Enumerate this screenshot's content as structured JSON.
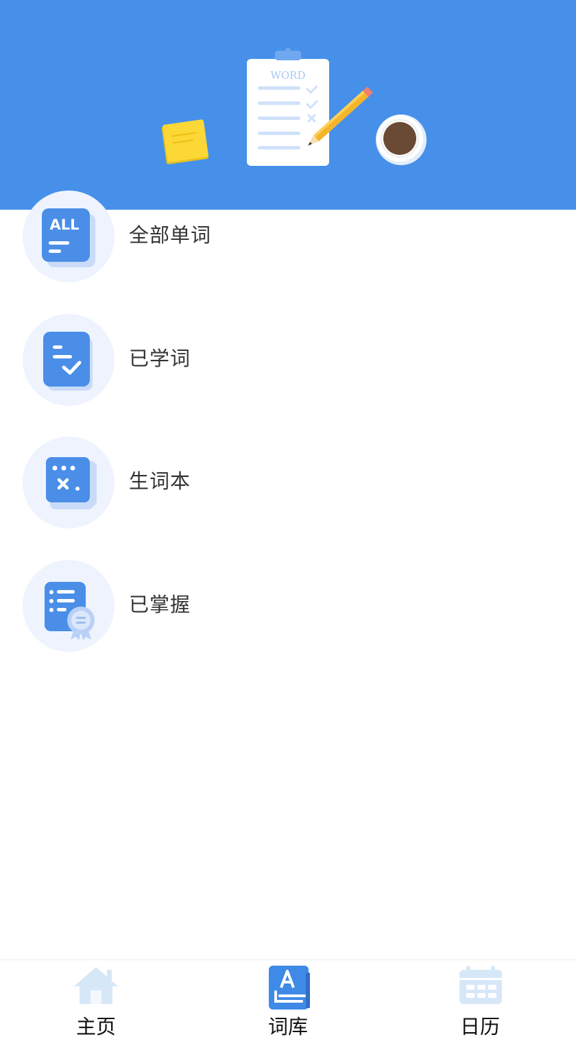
{
  "banner": {
    "illustration": "word-clipboard-illustration",
    "clipboard_text": "WORD",
    "color": "#4690ea"
  },
  "menu": {
    "items": [
      {
        "label": "全部单词",
        "icon": "all-words-icon",
        "icon_text": "ALL"
      },
      {
        "label": "已学词",
        "icon": "learned-words-icon"
      },
      {
        "label": "生词本",
        "icon": "new-words-notebook-icon"
      },
      {
        "label": "已掌握",
        "icon": "mastered-words-icon"
      }
    ]
  },
  "tabbar": {
    "tabs": [
      {
        "label": "主页",
        "icon": "home-icon",
        "active": false
      },
      {
        "label": "词库",
        "icon": "word-library-icon",
        "active": true
      },
      {
        "label": "日历",
        "icon": "calendar-icon",
        "active": false
      }
    ],
    "active_color": "#3f8ae6",
    "inactive_color": "#d6e7f8"
  }
}
